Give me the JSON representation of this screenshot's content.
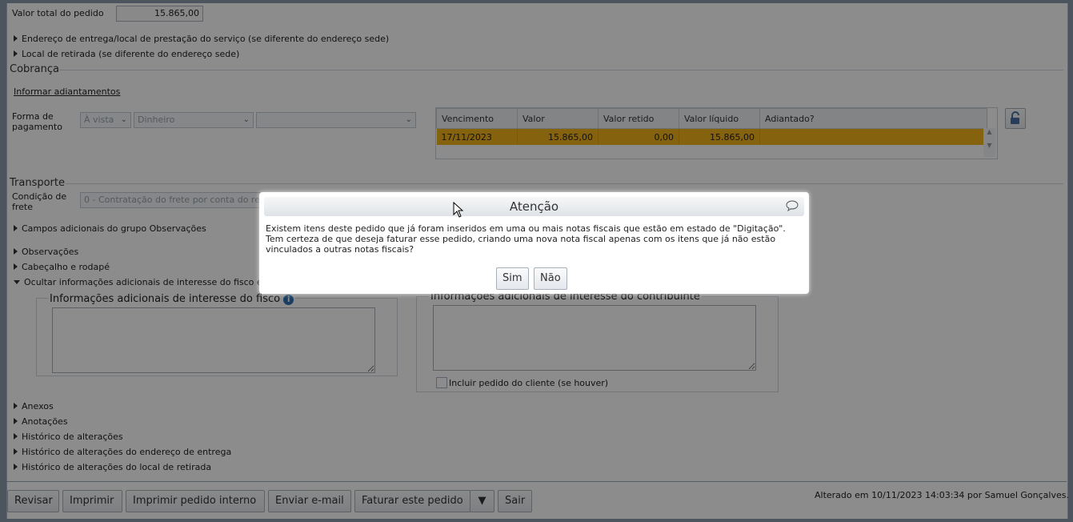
{
  "pedido": {
    "valor_total_label": "Valor total do pedido",
    "valor_total": "15.865,00"
  },
  "expanders_top": [
    "Endereço de entrega/local de prestação do serviço (se diferente do endereço sede)",
    "Local de retirada (se diferente do endereço sede)"
  ],
  "cobranca": {
    "legend": "Cobrança",
    "informar_link": "Informar adiantamentos",
    "forma_label_1": "Forma de",
    "forma_label_2": "pagamento",
    "select_prazo": "À vista",
    "select_meio": "Dinheiro",
    "select_extra": "",
    "table": {
      "headers": [
        "Vencimento",
        "Valor",
        "Valor retido",
        "Valor líquido",
        "Adiantado?"
      ],
      "rows": [
        [
          "17/11/2023",
          "15.865,00",
          "0,00",
          "15.865,00",
          ""
        ]
      ]
    }
  },
  "transporte": {
    "legend": "Transporte",
    "cond_label_1": "Condição de",
    "cond_label_2": "frete",
    "cond_value": "0 - Contratação do frete por conta do re"
  },
  "expanders_mid": [
    "Campos adicionais do grupo Observações",
    "Observações",
    "Cabeçalho e rodapé",
    "Ocultar informações adicionais de interesse do fisco e c"
  ],
  "info": {
    "fisco_legend": "Informações adicionais de interesse do fisco",
    "contrib_legend": "Informações adicionais de interesse do contribuinte",
    "incluir_label": "Incluir pedido do cliente (se houver)"
  },
  "expanders_bottom": [
    "Anexos",
    "Anotações",
    "Histórico de alterações",
    "Histórico de alterações do endereço de entrega",
    "Histórico de alterações do local de retirada"
  ],
  "footer": {
    "revisar": "Revisar",
    "imprimir": "Imprimir",
    "imprimir_interno": "Imprimir pedido interno",
    "enviar_email": "Enviar e-mail",
    "faturar": "Faturar este pedido",
    "faturar_arrow": "▼",
    "sair": "Sair",
    "alterado": "Alterado em 10/11/2023 14:03:34 por Samuel Gonçalves."
  },
  "dialog": {
    "title": "Atenção",
    "message": "Existem itens deste pedido que já foram inseridos em uma ou mais notas fiscais que estão em estado de \"Digitação\". Tem certeza de que deseja faturar esse pedido, criando uma nova nota fiscal apenas com os itens que já não estão vinculados a outras notas fiscais?",
    "sim": "Sim",
    "nao": "Não"
  },
  "icons": [
    "lock-icon",
    "info-icon",
    "comment-icon",
    "mouse-cursor-icon",
    "chevron-down-icon"
  ]
}
